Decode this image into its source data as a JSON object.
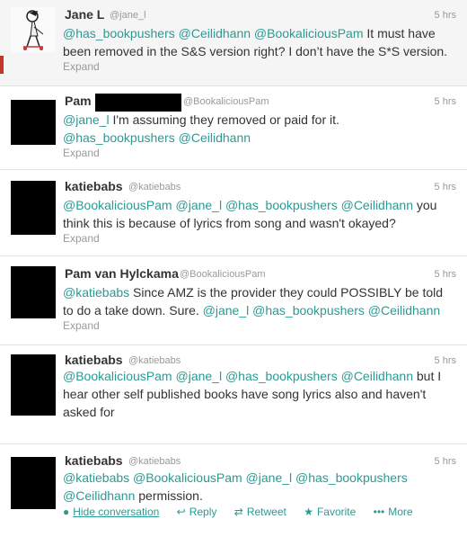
{
  "tweets": [
    {
      "name": "Jane L",
      "handle": "@jane_l",
      "time": "5 hrs",
      "segments": [
        {
          "t": "@has_bookpushers",
          "m": true
        },
        {
          "t": " ",
          "m": false
        },
        {
          "t": "@Ceilidhann",
          "m": true
        },
        {
          "t": " ",
          "m": false
        },
        {
          "t": "@BookaliciousPam",
          "m": true
        },
        {
          "t": " It must have been removed in the S&S version right? I don’t have the S*S version.",
          "m": false
        }
      ],
      "expand": "Expand"
    },
    {
      "name": "Pam",
      "handle": "@BookaliciousPam",
      "time": "5 hrs",
      "segments": [
        {
          "t": "@jane_l",
          "m": true
        },
        {
          "t": " I'm assuming they removed or paid for it. ",
          "m": false
        },
        {
          "t": "@has_bookpushers",
          "m": true
        },
        {
          "t": " ",
          "m": false
        },
        {
          "t": "@Ceilidhann",
          "m": true
        }
      ],
      "expand": "Expand"
    },
    {
      "name": "katiebabs",
      "handle": "@katiebabs",
      "time": "5 hrs",
      "segments": [
        {
          "t": "@BookaliciousPam",
          "m": true
        },
        {
          "t": " ",
          "m": false
        },
        {
          "t": "@jane_l",
          "m": true
        },
        {
          "t": " ",
          "m": false
        },
        {
          "t": "@has_bookpushers",
          "m": true
        },
        {
          "t": " ",
          "m": false
        },
        {
          "t": "@Ceilidhann",
          "m": true
        },
        {
          "t": " you think this is because of lyrics from song and wasn't okayed?",
          "m": false
        }
      ],
      "expand": "Expand"
    },
    {
      "name": "Pam van Hylckama",
      "handle": "@BookaliciousPam",
      "time": "5 hrs",
      "segments": [
        {
          "t": "@katiebabs",
          "m": true
        },
        {
          "t": " Since AMZ is the provider they could POSSIBLY be told to do a take down. Sure. ",
          "m": false
        },
        {
          "t": "@jane_l",
          "m": true
        },
        {
          "t": " ",
          "m": false
        },
        {
          "t": "@has_bookpushers",
          "m": true
        },
        {
          "t": " ",
          "m": false
        },
        {
          "t": "@Ceilidhann",
          "m": true
        }
      ],
      "expand": "Expand"
    },
    {
      "name": "katiebabs",
      "handle": "@katiebabs",
      "time": "5 hrs",
      "segments": [
        {
          "t": "@BookaliciousPam",
          "m": true
        },
        {
          "t": " ",
          "m": false
        },
        {
          "t": "@jane_l",
          "m": true
        },
        {
          "t": " ",
          "m": false
        },
        {
          "t": "@has_bookpushers",
          "m": true
        },
        {
          "t": " ",
          "m": false
        },
        {
          "t": "@Ceilidhann",
          "m": true
        },
        {
          "t": " but I hear other self published books have song lyrics also and haven't asked for",
          "m": false
        }
      ],
      "expand": ""
    },
    {
      "name": "katiebabs",
      "handle": "@katiebabs",
      "time": "5 hrs",
      "segments": [
        {
          "t": "@katiebabs",
          "m": true
        },
        {
          "t": " ",
          "m": false
        },
        {
          "t": "@BookaliciousPam",
          "m": true
        },
        {
          "t": " ",
          "m": false
        },
        {
          "t": "@jane_l",
          "m": true
        },
        {
          "t": " ",
          "m": false
        },
        {
          "t": "@has_bookpushers",
          "m": true
        },
        {
          "t": " ",
          "m": false
        },
        {
          "t": "@Ceilidhann",
          "m": true
        },
        {
          "t": " permission.",
          "m": false
        }
      ],
      "expand": ""
    }
  ],
  "actions": {
    "hide": "Hide conversation",
    "reply": "Reply",
    "retweet": "Retweet",
    "favorite": "Favorite",
    "more": "More"
  },
  "icons": {
    "hide": "chat-bubble-icon",
    "reply": "reply-arrow-icon",
    "retweet": "retweet-icon",
    "favorite": "star-icon",
    "more": "more-dots-icon"
  },
  "colors": {
    "mention": "#2a9a94",
    "background_highlight": "#f5f5f5",
    "background": "#ffffff"
  }
}
